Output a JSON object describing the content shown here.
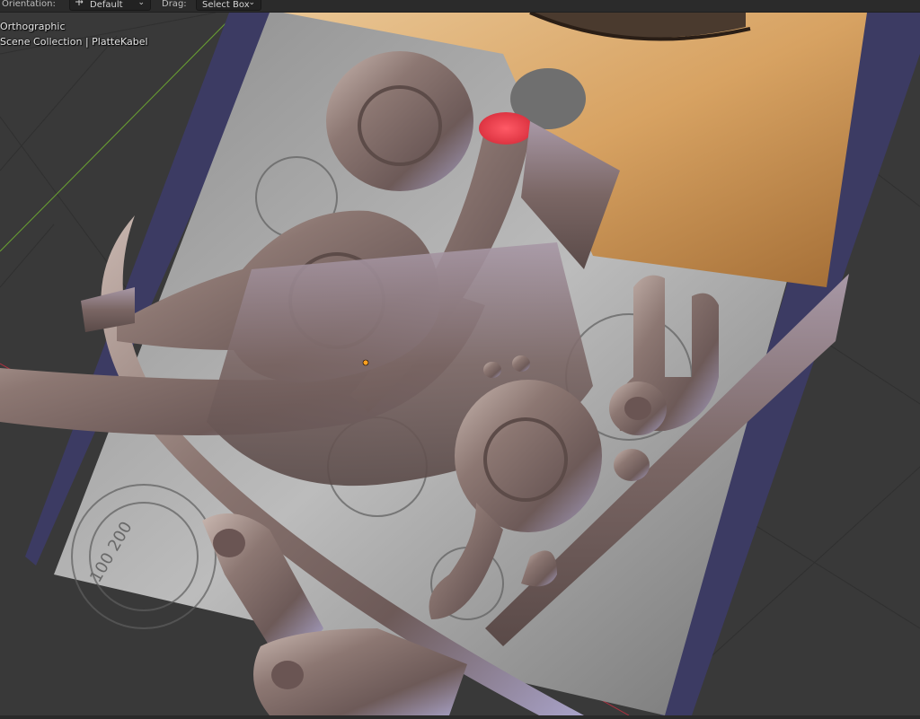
{
  "header": {
    "orientation_label": "Orientation:",
    "orientation_value": "Default",
    "drag_label": "Drag:",
    "drag_value": "Select Box",
    "chevron_icon": "chevron-down-icon"
  },
  "viewport": {
    "view_mode": "Orthographic",
    "collection_path": "Scene Collection | PlatteKabel",
    "background_color": "#393939",
    "x_axis_color": "#b03040",
    "y_axis_color": "#6aa232",
    "frame_color": "#3c3b63",
    "selected_face_color": "#e83a48",
    "origin_color": "#ffa020"
  }
}
